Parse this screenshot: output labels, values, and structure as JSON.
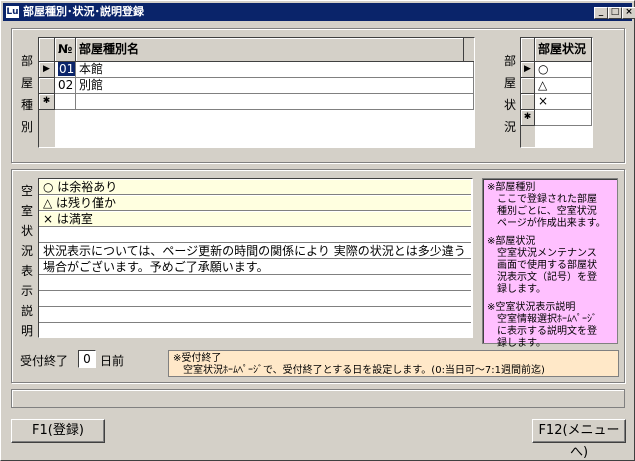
{
  "window": {
    "title": "部屋種別･状況･説明登録",
    "app_icon_text": "Lu",
    "min": "_",
    "max": "□",
    "close": "×"
  },
  "room_type": {
    "label_chars": [
      "部",
      "屋",
      "種",
      "別"
    ],
    "col_no": "№",
    "col_name": "部屋種別名",
    "rows": [
      {
        "marker": "▶",
        "no": "01",
        "name": "本館"
      },
      {
        "marker": "",
        "no": "02",
        "name": "別館"
      },
      {
        "marker": "✱",
        "no": "",
        "name": ""
      }
    ]
  },
  "room_status": {
    "label_chars": [
      "部",
      "屋",
      "状",
      "況"
    ],
    "col_status": "部屋状況",
    "rows": [
      {
        "marker": "▶",
        "value": "○"
      },
      {
        "marker": "",
        "value": "△"
      },
      {
        "marker": "",
        "value": "×"
      },
      {
        "marker": "✱",
        "value": ""
      }
    ]
  },
  "description": {
    "label_chars": [
      "空",
      "室",
      "状",
      "況",
      "表",
      "示",
      "説",
      "明"
    ],
    "lines": [
      "○ は余裕あり",
      "△ は残り僅か",
      "× は満室",
      "",
      "状況表示については、ページ更新の時間の関係により 実際の状況とは多少違う",
      "場合がございます。予めご了承願います。",
      "",
      "",
      "",
      ""
    ],
    "note_lines": [
      "※部屋種別",
      "　ここで登録された部屋",
      "　種別ごとに、空室状況",
      "　ページが作成出来ます。",
      "",
      "※部屋状況",
      "　空室状況メンテナンス",
      "　画面で使用する部屋状",
      "　況表示文（記号）を登",
      "　録します。",
      "",
      "※空室状況表示説明",
      "　空室情報選択ﾎｰﾑﾍﾟｰｼﾞ",
      "　に表示する説明文を登",
      "　録します。"
    ]
  },
  "deadline": {
    "label": "受付終了",
    "value": "0",
    "unit": "日前",
    "note_title": "※受付終了",
    "note_text": "　空室状況ﾎｰﾑﾍﾟｰｼﾞで、受付終了とする日を設定します。(0:当日可～7:1週間前迄)"
  },
  "buttons": {
    "f1": "F1(登録)",
    "f12": "F12(メニューへ)"
  }
}
